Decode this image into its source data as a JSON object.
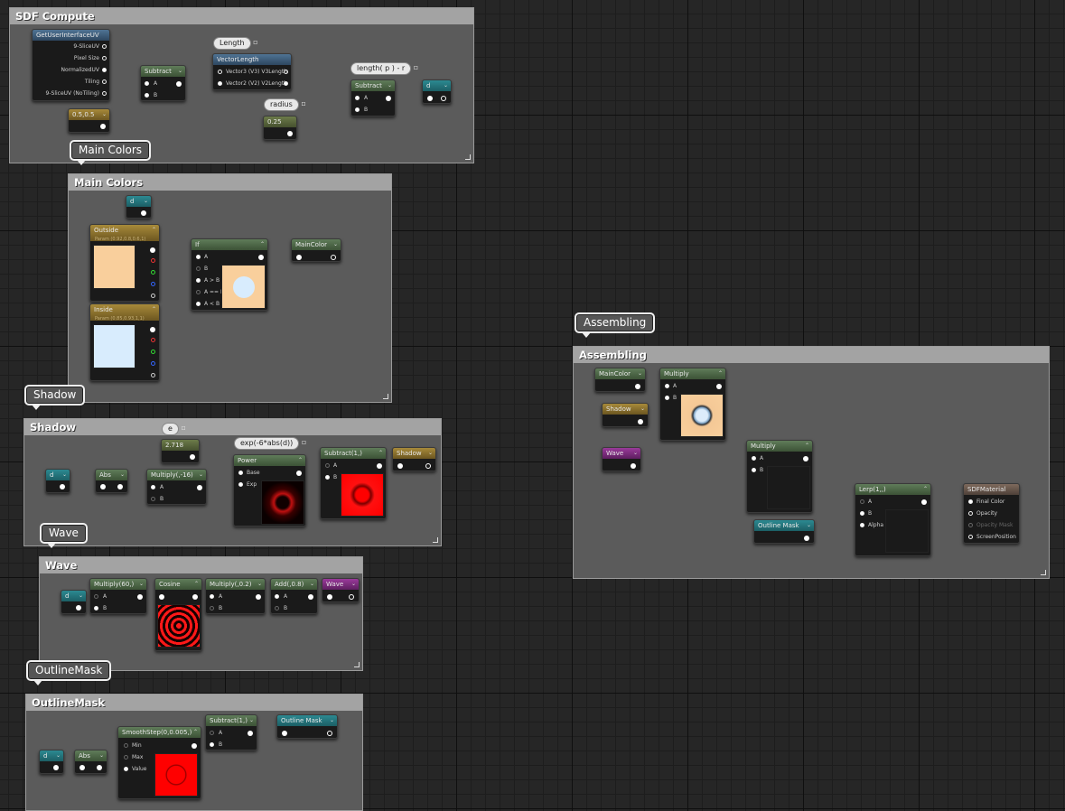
{
  "comments": {
    "sdf_compute": "SDF Compute",
    "main_colors": "Main Colors",
    "shadow": "Shadow",
    "wave": "Wave",
    "outline_mask": "OutlineMask",
    "assembling": "Assembling"
  },
  "bubbles": {
    "main_colors": "Main Colors",
    "shadow": "Shadow",
    "wave": "Wave",
    "outline_mask": "OutlineMask",
    "assembling": "Assembling"
  },
  "sdf": {
    "get_ui_uv": "GetUserInterfaceUV",
    "uv_pins": [
      "9-SliceUV",
      "Pixel Size",
      "NormalizedUV",
      "Tiling",
      "9-SliceUV (NoTiling)"
    ],
    "const_half": "0.5,0.5",
    "subtract1": "Subtract",
    "pin_a": "A",
    "pin_b": "B",
    "length_pill": "Length",
    "vector_length": "VectorLength",
    "vl_pins": [
      "Vector3 (V3)  V3Length",
      "Vector2 (V2)  V2Length"
    ],
    "radius_pill": "radius",
    "const_radius": "0.25",
    "expr_pill": "length( p ) - r",
    "subtract2": "Subtract",
    "out_d": "d"
  },
  "main_colors": {
    "d": "d",
    "outside": "Outside",
    "outside_param": "Param (0.92,0.8,0.6,1)",
    "inside": "Inside",
    "inside_param": "Param (0.85,0.93,1,1)",
    "if_node": "If",
    "if_pins": [
      "A",
      "B",
      "A > B",
      "A == B",
      "A < B"
    ],
    "main_color_out": "MainColor",
    "outside_hex": "#f9cf9c",
    "inside_hex": "#d8ecfd"
  },
  "shadow": {
    "e_pill": "e",
    "const_e": "2.718",
    "expr_pill": "exp(-6*abs(d))",
    "d": "d",
    "abs": "Abs",
    "multiply": "Multiply(,-16)",
    "pin_a": "A",
    "pin_b": "B",
    "power": "Power",
    "power_pins": [
      "Base",
      "Exp"
    ],
    "subtract": "Subtract(1,)",
    "shadow_out": "Shadow"
  },
  "wave": {
    "d": "d",
    "multiply60": "Multiply(60,)",
    "cosine": "Cosine",
    "multiply02": "Multiply(,0.2)",
    "add": "Add(,0.8)",
    "wave_out": "Wave",
    "pin_a": "A",
    "pin_b": "B"
  },
  "outline": {
    "d": "d",
    "abs": "Abs",
    "smoothstep": "SmoothStep(0,0.005,)",
    "smooth_pins": [
      "Min",
      "Max",
      "Value"
    ],
    "subtract": "Subtract(1,)",
    "outline_out": "Outline Mask",
    "pin_a": "A",
    "pin_b": "B"
  },
  "assembling": {
    "main_color": "MainColor",
    "shadow": "Shadow",
    "multiply1": "Multiply",
    "wave": "Wave",
    "multiply2": "Multiply",
    "outline_mask": "Outline Mask",
    "lerp": "Lerp(1,,)",
    "lerp_pins": [
      "A",
      "B",
      "Alpha"
    ],
    "pin_a": "A",
    "pin_b": "B",
    "material": "SDFMaterial",
    "material_pins": [
      "Final Color",
      "Opacity",
      "Opacity Mask",
      "ScreenPosition"
    ]
  },
  "colors": {
    "accent_red": "#ff0000",
    "comment_bg": "#5b5b5b",
    "comment_header": "#a3a3a3"
  }
}
